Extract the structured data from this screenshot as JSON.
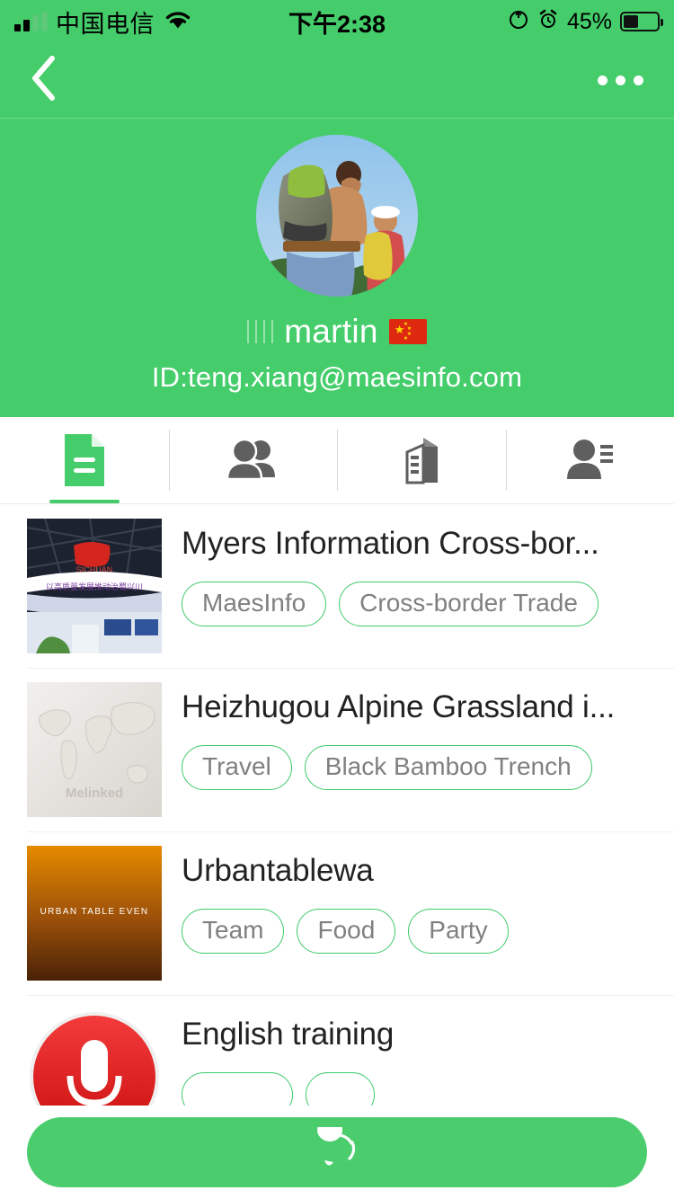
{
  "status_bar": {
    "carrier": "中国电信",
    "time": "下午2:38",
    "battery_percent": "45%",
    "signal_icon": "signal-bars-icon",
    "wifi_icon": "wifi-icon",
    "rotation_lock_icon": "rotation-lock-icon",
    "alarm_icon": "alarm-clock-icon",
    "battery_icon": "battery-icon"
  },
  "nav": {
    "back_icon": "back-chevron-icon",
    "more_icon": "more-options-icon"
  },
  "profile": {
    "avatar_icon": "user-avatar-photo",
    "username": "martin",
    "name_prefix": "||||",
    "flag": "china-flag-icon",
    "id_label": "ID:teng.xiang@maesinfo.com"
  },
  "tabs": [
    {
      "name": "tab-documents",
      "icon": "document-icon",
      "active": true
    },
    {
      "name": "tab-groups",
      "icon": "people-group-icon",
      "active": false
    },
    {
      "name": "tab-companies",
      "icon": "building-icon",
      "active": false
    },
    {
      "name": "tab-contacts",
      "icon": "contact-card-icon",
      "active": false
    }
  ],
  "list": [
    {
      "title": "Myers Information Cross-bor...",
      "thumb": "exhibition-booth-photo",
      "tags": [
        "MaesInfo",
        "Cross-border Trade"
      ]
    },
    {
      "title": "Heizhugou Alpine Grassland i...",
      "thumb": "world-map-placeholder",
      "thumb_watermark": "Melinked",
      "tags": [
        "Travel",
        "Black Bamboo Trench"
      ]
    },
    {
      "title": "Urbantablewa",
      "thumb": "urban-table-event-poster",
      "thumb_caption": "URBAN TABLE EVEN",
      "tags": [
        "Team",
        "Food",
        "Party"
      ]
    },
    {
      "title": "English training",
      "thumb": "microphone-logo",
      "tags": [
        "",
        ""
      ]
    }
  ],
  "fab": {
    "icon": "chat-bubble-icon"
  },
  "colors": {
    "brand_green": "#44cd6a",
    "tag_border": "#3ec96b",
    "fab_green": "#4bcd6d",
    "tab_inactive": "#5f5f5f",
    "title_text": "#222222",
    "tag_text": "#808080"
  }
}
